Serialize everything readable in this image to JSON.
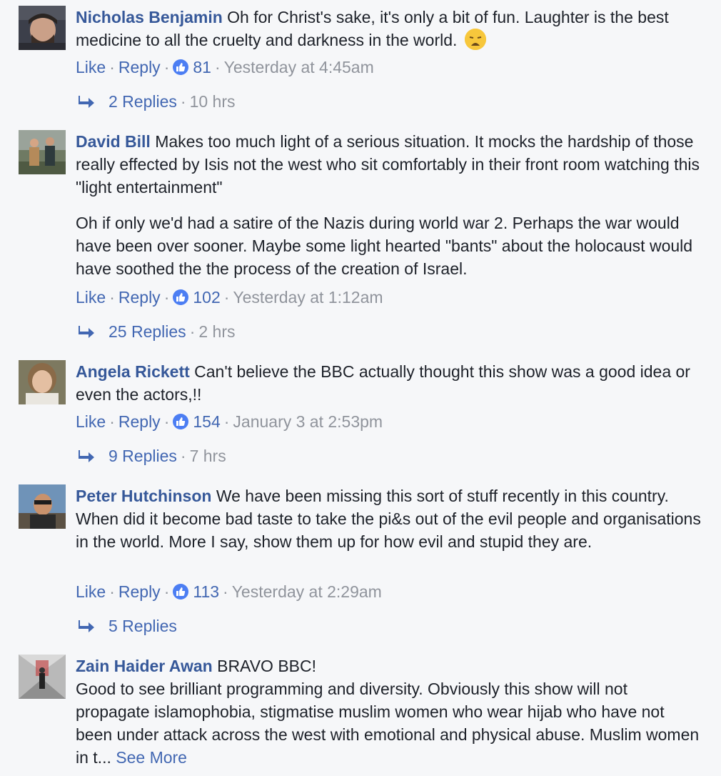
{
  "comments": [
    {
      "name": "Nicholas Benjamin",
      "paragraphs": [
        "Oh for Christ's sake, it's only a bit of fun. Laughter is the best medicine to all the cruelty and darkness in the world."
      ],
      "emoji": "weary-face-emoji",
      "like_label": "Like",
      "reply_label": "Reply",
      "reactions": "81",
      "timestamp": "Yesterday at 4:45am",
      "replies_label": "2 Replies",
      "replies_time": "10 hrs"
    },
    {
      "name": "David Bill",
      "paragraphs": [
        "Makes too much light of a serious situation. It mocks the hardship of those really effected by Isis not the west who sit comfortably in their front room watching this \"light entertainment\"",
        "Oh if only we'd had a satire of the Nazis during world war 2. Perhaps the war would have been over sooner. Maybe some light hearted \"bants\" about the holocaust would have soothed the the process of the creation of Israel."
      ],
      "like_label": "Like",
      "reply_label": "Reply",
      "reactions": "102",
      "timestamp": "Yesterday at 1:12am",
      "replies_label": "25 Replies",
      "replies_time": "2 hrs"
    },
    {
      "name": "Angela Rickett",
      "paragraphs": [
        "Can't believe the BBC actually thought this show was a good idea or even the actors,!!"
      ],
      "like_label": "Like",
      "reply_label": "Reply",
      "reactions": "154",
      "timestamp": "January 3 at 2:53pm",
      "replies_label": "9 Replies",
      "replies_time": "7 hrs"
    },
    {
      "name": "Peter Hutchinson",
      "paragraphs": [
        "We have been missing this sort of stuff recently in this country. When did it become bad taste to take the pi&s out of the evil people and organisations in the world. More I say, show them up for how evil and stupid they are."
      ],
      "like_label": "Like",
      "reply_label": "Reply",
      "reactions": "113",
      "timestamp": "Yesterday at 2:29am",
      "replies_label": "5 Replies"
    },
    {
      "name": "Zain Haider Awan",
      "paragraphs": [
        "BRAVO BBC!",
        "Good to see brilliant programming and diversity. Obviously this show will not propagate islamophobia, stigmatise muslim women who wear hijab who have not been under attack across the west with emotional and physical abuse. Muslim women in t..."
      ],
      "see_more": "See More"
    }
  ],
  "colors": {
    "name": "#365899",
    "link": "#4267b2",
    "meta": "#90949c",
    "like_badge": "#4c7ef3",
    "background": "#f6f7f9"
  }
}
